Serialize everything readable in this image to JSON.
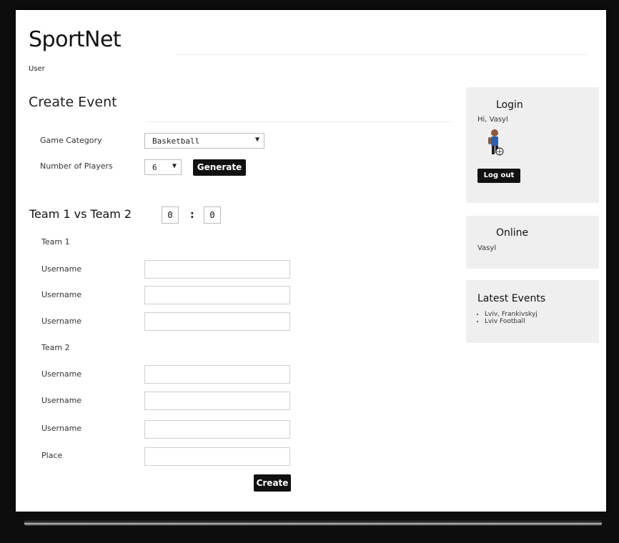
{
  "site": {
    "title": "SportNet",
    "user_link": "User"
  },
  "form": {
    "heading": "Create Event",
    "game_category_label": "Game Category",
    "game_category_value": "Basketball",
    "players_label": "Number of Players",
    "players_value": "6",
    "generate_label": "Generate",
    "versus_title": "Team 1 vs Team 2",
    "score": [
      "0",
      "0"
    ],
    "score_separator": ":",
    "team1_label": "Team 1",
    "team2_label": "Team 2",
    "team1_fields": [
      "Username",
      "Username",
      "Username"
    ],
    "team2_fields": [
      "Username",
      "Username",
      "Username"
    ],
    "place_label": "Place",
    "create_label": "Create"
  },
  "sidebar": {
    "login": {
      "title": "Login",
      "greeting": "Hi, Vasyl",
      "logout_label": "Log out"
    },
    "online": {
      "title": "Online",
      "users": [
        "Vasyl"
      ]
    },
    "latest_events": {
      "title": "Latest Events",
      "items": [
        "Lviv, Frankivskyj",
        "Lviv Football"
      ]
    }
  },
  "icons": {
    "dropdown": "triangle-down-icon",
    "avatar": "basketball-player-icon"
  }
}
